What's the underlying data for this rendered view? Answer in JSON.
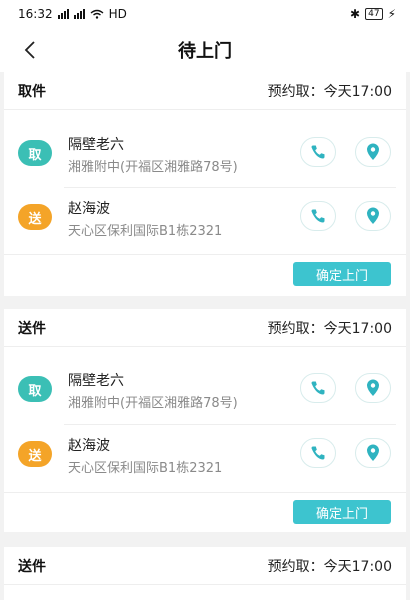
{
  "status_bar": {
    "time": "16:32",
    "network": "HD",
    "battery": "47"
  },
  "header": {
    "back_icon": "chevron-left-icon",
    "title": "待上门"
  },
  "colors": {
    "pickup_badge": "#3bbfb5",
    "deliver_badge": "#f4a428",
    "accent": "#3dc4cf"
  },
  "orders": [
    {
      "title": "取件",
      "appointment": "预约取：今天17:00",
      "entries": [
        {
          "badge": "取",
          "name": "隔壁老六",
          "address": "湘雅附中(开福区湘雅路78号)"
        },
        {
          "badge": "送",
          "name": "赵海波",
          "address": "天心区保利国际B1栋2321"
        }
      ],
      "confirm_label": "确定上门"
    },
    {
      "title": "送件",
      "appointment": "预约取：今天17:00",
      "entries": [
        {
          "badge": "取",
          "name": "隔壁老六",
          "address": "湘雅附中(开福区湘雅路78号)"
        },
        {
          "badge": "送",
          "name": "赵海波",
          "address": "天心区保利国际B1栋2321"
        }
      ],
      "confirm_label": "确定上门"
    },
    {
      "title": "送件",
      "appointment": "预约取：今天17:00"
    }
  ]
}
